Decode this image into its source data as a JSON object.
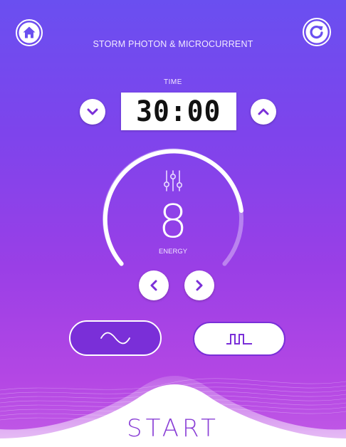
{
  "header": {
    "title": "STORM PHOTON & MICROCURRENT",
    "home_icon": "home-icon",
    "refresh_icon": "refresh-icon"
  },
  "timer": {
    "label": "TIME",
    "value": "30:00",
    "decrease_icon": "chevron-down-icon",
    "increase_icon": "chevron-up-icon"
  },
  "energy": {
    "value": "8",
    "label": "ENERGY",
    "icon": "sliders-icon",
    "decrease_icon": "chevron-left-icon",
    "increase_icon": "chevron-right-icon"
  },
  "waveform": {
    "options": [
      "sine-wave-icon",
      "square-wave-icon"
    ],
    "selected": "sine-wave-icon"
  },
  "footer": {
    "start_label": "START"
  },
  "colors": {
    "accent": "#7a2fd8",
    "background_top": "#6a4ff0",
    "background_bottom": "#c25be6"
  }
}
